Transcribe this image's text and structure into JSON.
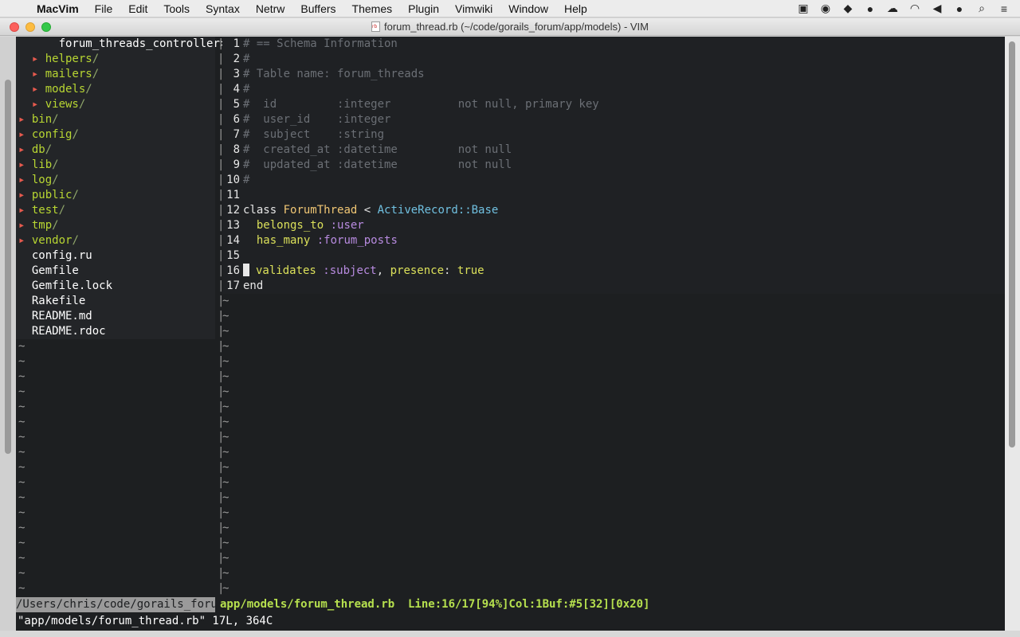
{
  "menubar": {
    "app_name": "MacVim",
    "items": [
      "File",
      "Edit",
      "Tools",
      "Syntax",
      "Netrw",
      "Buffers",
      "Themes",
      "Plugin",
      "Vimwiki",
      "Window",
      "Help"
    ],
    "status_icons": [
      "facetime-camera-icon",
      "bell-icon",
      "dropbox-icon",
      "coffee-icon",
      "cloud-icon",
      "wifi-icon",
      "volume-icon",
      "user-icon",
      "spotlight-search-icon",
      "list-icon"
    ]
  },
  "window": {
    "title": "forum_thread.rb (~/code/gorails_forum/app/models) - VIM"
  },
  "tree": {
    "header": "forum_threads_controller>",
    "items": [
      {
        "arrow": "▸",
        "name": "helpers",
        "indent": "  "
      },
      {
        "arrow": "▸",
        "name": "mailers",
        "indent": "  "
      },
      {
        "arrow": "▸",
        "name": "models",
        "indent": "  "
      },
      {
        "arrow": "▸",
        "name": "views",
        "indent": "  "
      },
      {
        "arrow": "▸",
        "name": "bin",
        "indent": ""
      },
      {
        "arrow": "▸",
        "name": "config",
        "indent": ""
      },
      {
        "arrow": "▸",
        "name": "db",
        "indent": ""
      },
      {
        "arrow": "▸",
        "name": "lib",
        "indent": ""
      },
      {
        "arrow": "▸",
        "name": "log",
        "indent": ""
      },
      {
        "arrow": "▸",
        "name": "public",
        "indent": ""
      },
      {
        "arrow": "▸",
        "name": "test",
        "indent": ""
      },
      {
        "arrow": "▸",
        "name": "tmp",
        "indent": ""
      },
      {
        "arrow": "▸",
        "name": "vendor",
        "indent": ""
      }
    ],
    "files": [
      "config.ru",
      "Gemfile",
      "Gemfile.lock",
      "Rakefile",
      "README.md",
      "README.rdoc"
    ],
    "tilde": "~"
  },
  "editor": {
    "lines": [
      {
        "n": "1",
        "text": "# == Schema Information"
      },
      {
        "n": "2",
        "text": "#"
      },
      {
        "n": "3",
        "text": "# Table name: forum_threads"
      },
      {
        "n": "4",
        "text": "#"
      },
      {
        "n": "5",
        "text": "#  id         :integer          not null, primary key"
      },
      {
        "n": "6",
        "text": "#  user_id    :integer"
      },
      {
        "n": "7",
        "text": "#  subject    :string"
      },
      {
        "n": "8",
        "text": "#  created_at :datetime         not null"
      },
      {
        "n": "9",
        "text": "#  updated_at :datetime         not null"
      },
      {
        "n": "10",
        "text": "#"
      },
      {
        "n": "11",
        "text": ""
      },
      {
        "n": "12",
        "text": "class ForumThread < ActiveRecord::Base"
      },
      {
        "n": "13",
        "text": "  belongs_to :user"
      },
      {
        "n": "14",
        "text": "  has_many :forum_posts"
      },
      {
        "n": "15",
        "text": ""
      },
      {
        "n": "16",
        "text": "  validates :subject, presence: true"
      },
      {
        "n": "17",
        "text": "end"
      }
    ],
    "tilde": "~"
  },
  "statusline": {
    "left": "/Users/chris/code/gorails_forum",
    "right": "app/models/forum_thread.rb  Line:16/17[94%]Col:1Buf:#5[32][0x20]"
  },
  "cmdline": "\"app/models/forum_thread.rb\" 17L, 364C",
  "colors": {
    "background": "#1d1f21",
    "directory": "#b8d632",
    "arrow": "#e65a4e",
    "comment": "#6b6f75",
    "status_green": "#b6e04e"
  }
}
